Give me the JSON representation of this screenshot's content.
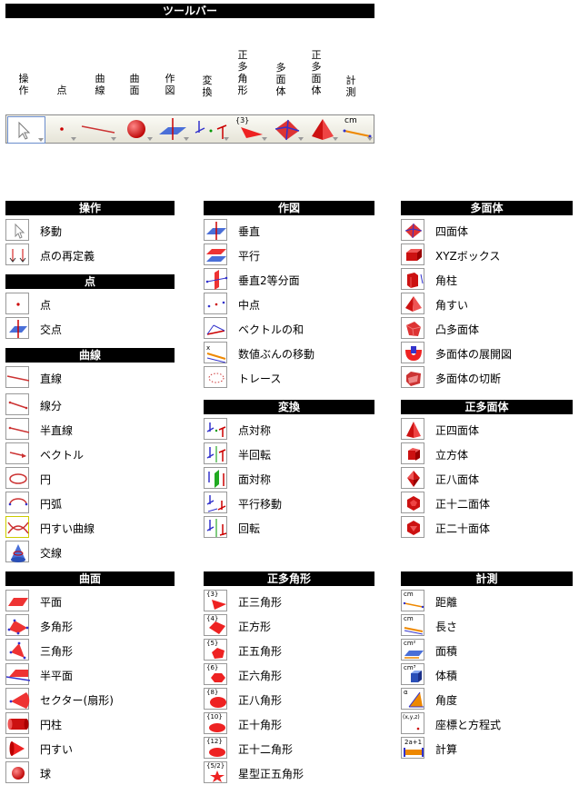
{
  "toolbar_title": "ツールバー",
  "vertical_labels": [
    {
      "chars": [
        "操",
        "作"
      ]
    },
    {
      "chars": [
        "点"
      ]
    },
    {
      "chars": [
        "曲",
        "線"
      ]
    },
    {
      "chars": [
        "曲",
        "面"
      ]
    },
    {
      "chars": [
        "作",
        "図"
      ]
    },
    {
      "chars": [
        "変",
        "換"
      ]
    },
    {
      "chars": [
        "正",
        "多",
        "角",
        "形"
      ]
    },
    {
      "chars": [
        "多",
        "面",
        "体"
      ]
    },
    {
      "chars": [
        "正",
        "多",
        "面",
        "体"
      ]
    },
    {
      "chars": [
        "計",
        "測"
      ]
    }
  ],
  "toolbar_badges": {
    "polygon": "{3}",
    "measure": "cm"
  },
  "sections": {
    "operation": {
      "title": "操作",
      "items": [
        "移動",
        "点の再定義"
      ]
    },
    "point": {
      "title": "点",
      "items": [
        "点",
        "交点"
      ]
    },
    "curve": {
      "title": "曲線",
      "items": [
        "直線",
        "線分",
        "半直線",
        "ベクトル",
        "円",
        "円弧",
        "円すい曲線",
        "交線"
      ]
    },
    "surface": {
      "title": "曲面",
      "items": [
        "平面",
        "多角形",
        "三角形",
        "半平面",
        "セクター(扇形)",
        "円柱",
        "円すい",
        "球"
      ]
    },
    "construct": {
      "title": "作図",
      "items": [
        "垂直",
        "平行",
        "垂直2等分面",
        "中点",
        "ベクトルの和",
        "数値ぶんの移動",
        "トレース"
      ]
    },
    "transform": {
      "title": "変換",
      "items": [
        "点対称",
        "半回転",
        "面対称",
        "平行移動",
        "回転"
      ]
    },
    "regpoly": {
      "title": "正多角形",
      "items": [
        "正三角形",
        "正方形",
        "正五角形",
        "正六角形",
        "正八角形",
        "正十角形",
        "正十二角形",
        "星型正五角形"
      ],
      "badges": [
        "{3}",
        "{4}",
        "{5}",
        "{6}",
        "{8}",
        "{10}",
        "{12}",
        "{5/2}"
      ]
    },
    "polyhedron": {
      "title": "多面体",
      "items": [
        "四面体",
        "XYZボックス",
        "角柱",
        "角すい",
        "凸多面体",
        "多面体の展開図",
        "多面体の切断"
      ]
    },
    "regpolyhedron": {
      "title": "正多面体",
      "items": [
        "正四面体",
        "立方体",
        "正八面体",
        "正十二面体",
        "正二十面体"
      ]
    },
    "measure": {
      "title": "計測",
      "items": [
        "距離",
        "長さ",
        "面積",
        "体積",
        "角度",
        "座標と方程式",
        "計算"
      ],
      "badges": [
        "cm",
        "cm",
        "cm²",
        "cm³",
        "α",
        "(x,y,z)",
        "2a+1"
      ]
    }
  }
}
